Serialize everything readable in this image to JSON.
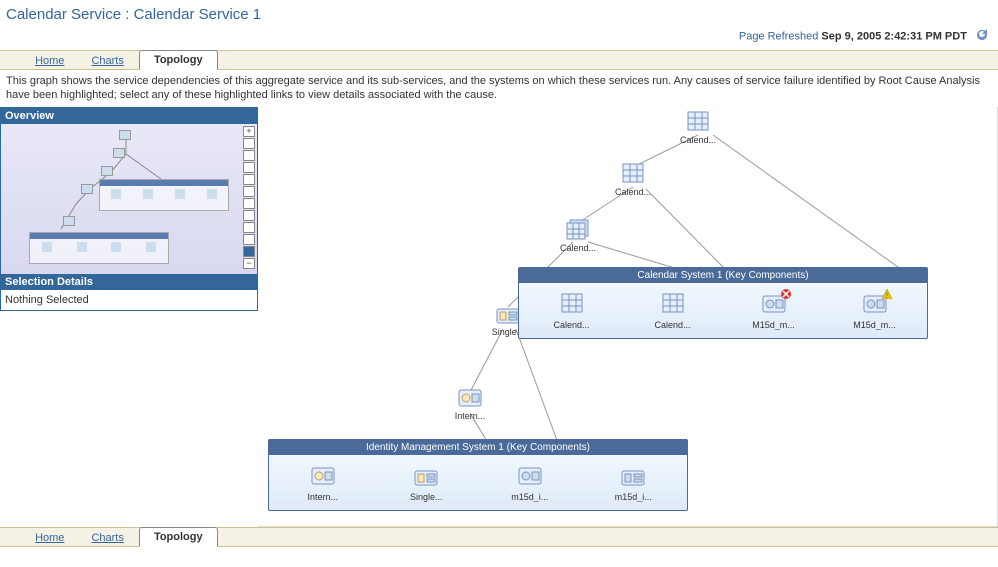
{
  "title_prefix": "Calendar Service : ",
  "title_name": "Calendar Service 1",
  "refresh_label": "Page Refreshed",
  "refresh_ts": "Sep 9, 2005 2:42:31 PM PDT",
  "tabs": {
    "home": "Home",
    "charts": "Charts",
    "topology": "Topology"
  },
  "description": "This graph shows the service dependencies of this aggregate service and its sub-services, and the systems on which these services run. Any causes of service failure identified by Root Cause Analysis have been highlighted; select any of these highlighted links to view details associated with the cause.",
  "overview_header": "Overview",
  "selection_header": "Selection Details",
  "selection_value": "Nothing Selected",
  "zoom": {
    "plus": "+",
    "minus": "−"
  },
  "nodes": {
    "calend1": "Calend...",
    "calend2": "Calend...",
    "calend3": "Calend...",
    "single": "Single...",
    "intern": "Intern..."
  },
  "groups": {
    "calendar": {
      "title": "Calendar System 1 (Key Components)",
      "items": [
        {
          "label": "Calend...",
          "icon": "grid",
          "status": "none"
        },
        {
          "label": "Calend...",
          "icon": "grid",
          "status": "none"
        },
        {
          "label": "M15d_m...",
          "icon": "comp",
          "status": "error"
        },
        {
          "label": "M15d_m...",
          "icon": "comp",
          "status": "warn"
        }
      ]
    },
    "identity": {
      "title": "Identity Management System 1 (Key Components)",
      "items": [
        {
          "label": "Intern...",
          "icon": "comp",
          "status": "none"
        },
        {
          "label": "Single...",
          "icon": "module",
          "status": "none"
        },
        {
          "label": "m15d_i...",
          "icon": "comp",
          "status": "none"
        },
        {
          "label": "m15d_i...",
          "icon": "module",
          "status": "none"
        }
      ]
    }
  }
}
